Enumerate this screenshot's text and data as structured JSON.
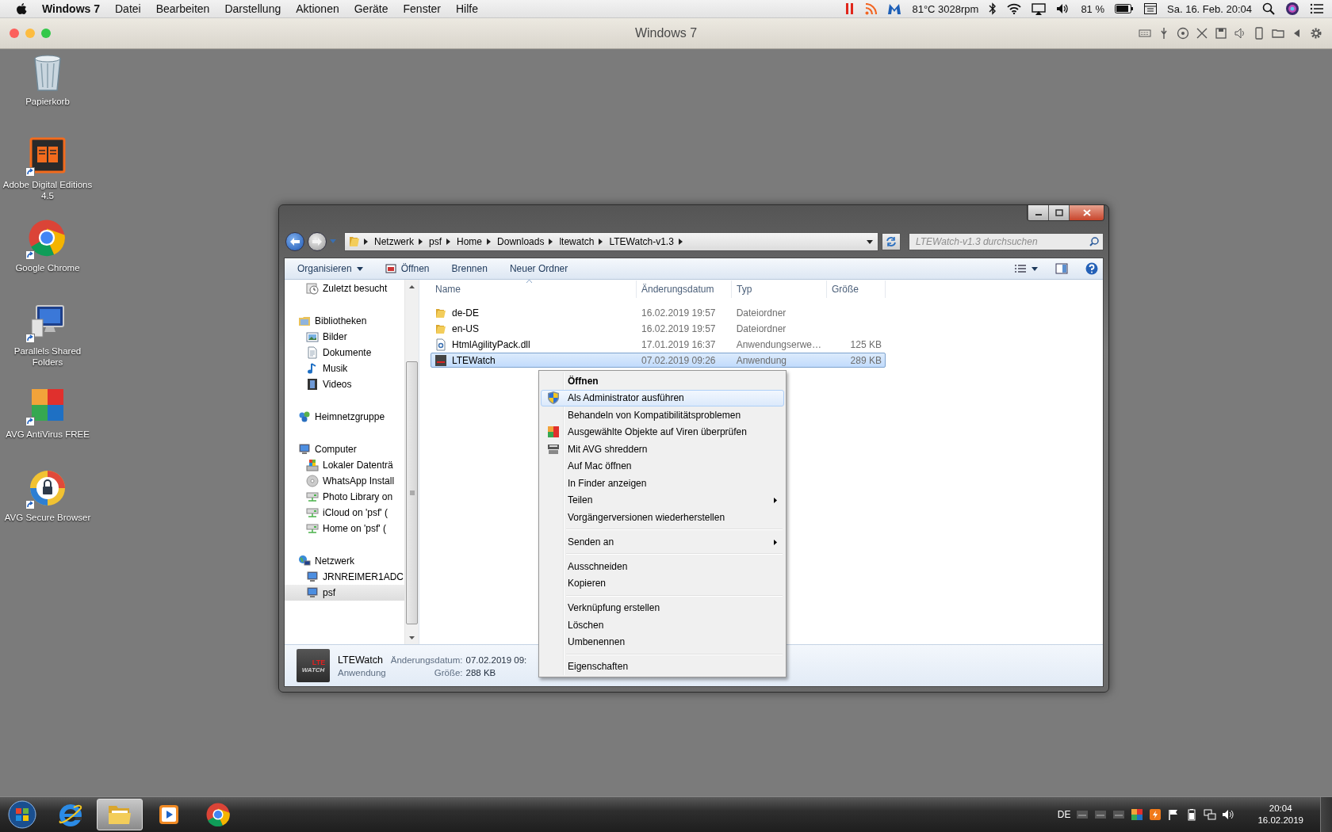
{
  "menubar": {
    "app_name": "Windows 7",
    "menus": [
      "Datei",
      "Bearbeiten",
      "Darstellung",
      "Aktionen",
      "Geräte",
      "Fenster",
      "Hilfe"
    ],
    "sensor_reading": "81°C 3028rpm",
    "battery_percent": "81 %",
    "clock": "Sa. 16. Feb. 20:04"
  },
  "vm_window": {
    "title": "Windows 7"
  },
  "desktop_icons": [
    {
      "label": "Papierkorb",
      "kind": "trash",
      "shortcut": false
    },
    {
      "label": "Adobe Digital Editions 4.5",
      "kind": "book",
      "shortcut": true
    },
    {
      "label": "Google Chrome",
      "kind": "chrome",
      "shortcut": true
    },
    {
      "label": "Parallels Shared Folders",
      "kind": "monitor",
      "shortcut": true
    },
    {
      "label": "AVG AntiVirus FREE",
      "kind": "avg",
      "shortcut": true
    },
    {
      "label": "AVG Secure Browser",
      "kind": "lock",
      "shortcut": true
    }
  ],
  "explorer": {
    "breadcrumb": [
      "Netzwerk",
      "psf",
      "Home",
      "Downloads",
      "ltewatch",
      "LTEWatch-v1.3"
    ],
    "search": {
      "placeholder": "LTEWatch-v1.3 durchsuchen"
    },
    "toolbar": [
      {
        "label": "Organisieren",
        "kind": "dropdown"
      },
      {
        "label": "Öffnen",
        "kind": "icon"
      },
      {
        "label": "Brennen",
        "kind": "plain"
      },
      {
        "label": "Neuer Ordner",
        "kind": "plain"
      }
    ],
    "nav": [
      {
        "children": [
          {
            "label": "Zuletzt besucht",
            "kind": "recent",
            "selected": false
          }
        ]
      },
      {
        "label": "Bibliotheken",
        "kind": "library",
        "selected": false,
        "children": [
          {
            "label": "Bilder",
            "kind": "pictures",
            "selected": false
          },
          {
            "label": "Dokumente",
            "kind": "document",
            "selected": false
          },
          {
            "label": "Musik",
            "kind": "music",
            "selected": false
          },
          {
            "label": "Videos",
            "kind": "film",
            "selected": false
          }
        ]
      },
      {
        "label": "Heimnetzgruppe",
        "kind": "homegroup",
        "selected": false
      },
      {
        "label": "Computer",
        "kind": "computer",
        "selected": false,
        "children": [
          {
            "label": "Lokaler Datenträ",
            "kind": "drive",
            "selected": false
          },
          {
            "label": "WhatsApp Install",
            "kind": "disc",
            "selected": false
          },
          {
            "label": "Photo Library on",
            "kind": "netdrive",
            "selected": false
          },
          {
            "label": "iCloud on 'psf' (",
            "kind": "netdrive",
            "selected": false
          },
          {
            "label": "Home on 'psf' (",
            "kind": "netdrive",
            "selected": false
          }
        ]
      },
      {
        "label": "Netzwerk",
        "kind": "network",
        "selected": false,
        "children": [
          {
            "label": "JRNREIMER1ADC",
            "kind": "computer",
            "selected": false
          },
          {
            "label": "psf",
            "kind": "computer",
            "selected": true
          }
        ]
      }
    ],
    "columns": [
      "Name",
      "Änderungsdatum",
      "Typ",
      "Größe"
    ],
    "rows": [
      {
        "name": "de-DE",
        "date": "16.02.2019 19:57",
        "type": "Dateiordner",
        "kind": "folder",
        "selected": false
      },
      {
        "name": "en-US",
        "date": "16.02.2019 19:57",
        "type": "Dateiordner",
        "kind": "folder",
        "selected": false
      },
      {
        "name": "HtmlAgilityPack.dll",
        "date": "17.01.2019 16:37",
        "type": "Anwendungserwe…",
        "size": "125 KB",
        "kind": "dll",
        "selected": false
      },
      {
        "name": "LTEWatch",
        "date": "07.02.2019 09:26",
        "type": "Anwendung",
        "size": "289 KB",
        "kind": "app",
        "selected": true
      }
    ],
    "details": {
      "name": "LTEWatch",
      "type": "Anwendung",
      "date_label": "Änderungsdatum:",
      "date": "07.02.2019 09:",
      "size_label": "Größe:",
      "size": "288 KB",
      "logo_top": "LTE",
      "logo_bottom": "WATCH"
    }
  },
  "context_menu": {
    "items": [
      {
        "kind": "plain",
        "label": "Öffnen",
        "default": true,
        "selected": false,
        "submenu": false
      },
      {
        "kind": "shield",
        "label": "Als Administrator ausführen",
        "default": false,
        "selected": true,
        "submenu": false
      },
      {
        "kind": "plain",
        "label": "Behandeln von Kompatibilitätsproblemen",
        "default": false,
        "selected": false,
        "submenu": false
      },
      {
        "kind": "scan",
        "label": "Ausgewählte Objekte auf Viren überprüfen",
        "default": false,
        "selected": false,
        "submenu": false
      },
      {
        "kind": "shredder",
        "label": "Mit AVG shreddern",
        "default": false,
        "selected": false,
        "submenu": false
      },
      {
        "kind": "plain",
        "label": "Auf Mac öffnen",
        "default": false,
        "selected": false,
        "submenu": false
      },
      {
        "kind": "plain",
        "label": "In Finder anzeigen",
        "default": false,
        "selected": false,
        "submenu": false
      },
      {
        "kind": "plain",
        "label": "Teilen",
        "default": false,
        "selected": false,
        "submenu": true
      },
      {
        "kind": "plain",
        "label": "Vorgängerversionen wiederherstellen",
        "default": false,
        "selected": false,
        "submenu": false
      },
      {
        "kind": "separator"
      },
      {
        "kind": "plain",
        "label": "Senden an",
        "default": false,
        "selected": false,
        "submenu": true
      },
      {
        "kind": "separator"
      },
      {
        "kind": "plain",
        "label": "Ausschneiden",
        "default": false,
        "selected": false,
        "submenu": false
      },
      {
        "kind": "plain",
        "label": "Kopieren",
        "default": false,
        "selected": false,
        "submenu": false
      },
      {
        "kind": "separator"
      },
      {
        "kind": "plain",
        "label": "Verknüpfung erstellen",
        "default": false,
        "selected": false,
        "submenu": false
      },
      {
        "kind": "plain",
        "label": "Löschen",
        "default": false,
        "selected": false,
        "submenu": false
      },
      {
        "kind": "plain",
        "label": "Umbenennen",
        "default": false,
        "selected": false,
        "submenu": false
      },
      {
        "kind": "separator"
      },
      {
        "kind": "plain",
        "label": "Eigenschaften",
        "default": false,
        "selected": false,
        "submenu": false
      }
    ]
  },
  "taskbar": {
    "apps": [
      {
        "kind": "ie",
        "selected": false
      },
      {
        "kind": "explorer",
        "selected": true
      },
      {
        "kind": "media",
        "selected": false
      },
      {
        "kind": "chrome",
        "selected": false
      }
    ],
    "language": "DE",
    "time": "20:04",
    "date": "16.02.2019"
  }
}
